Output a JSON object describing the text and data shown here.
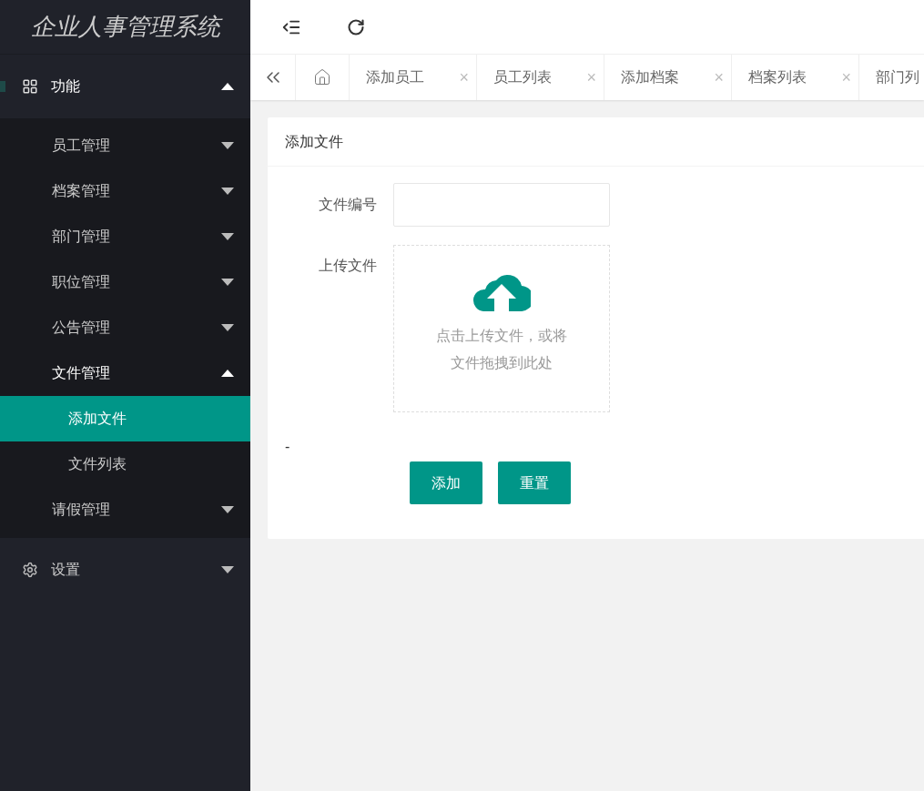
{
  "sidebar": {
    "logo": "企业人事管理系统",
    "groups": [
      {
        "label": "功能",
        "expanded": true,
        "items": [
          {
            "label": "员工管理",
            "expanded": false
          },
          {
            "label": "档案管理",
            "expanded": false
          },
          {
            "label": "部门管理",
            "expanded": false
          },
          {
            "label": "职位管理",
            "expanded": false
          },
          {
            "label": "公告管理",
            "expanded": false
          },
          {
            "label": "文件管理",
            "expanded": true,
            "children": [
              {
                "label": "添加文件",
                "selected": true
              },
              {
                "label": "文件列表",
                "selected": false
              }
            ]
          },
          {
            "label": "请假管理",
            "expanded": false
          }
        ]
      },
      {
        "label": "设置",
        "expanded": false
      }
    ]
  },
  "tabs": [
    {
      "label": "添加员工"
    },
    {
      "label": "员工列表"
    },
    {
      "label": "添加档案"
    },
    {
      "label": "档案列表"
    },
    {
      "label": "部门列"
    }
  ],
  "tab_close": "×",
  "card": {
    "title": "添加文件",
    "fields": [
      {
        "label": "文件编号",
        "kind": "input"
      },
      {
        "label": "上传文件",
        "kind": "upload",
        "hint_lines": [
          "点击上传文件，或将",
          "文件拖拽到此处"
        ]
      }
    ],
    "dash": "-",
    "buttons": [
      "添加",
      "重置"
    ]
  }
}
